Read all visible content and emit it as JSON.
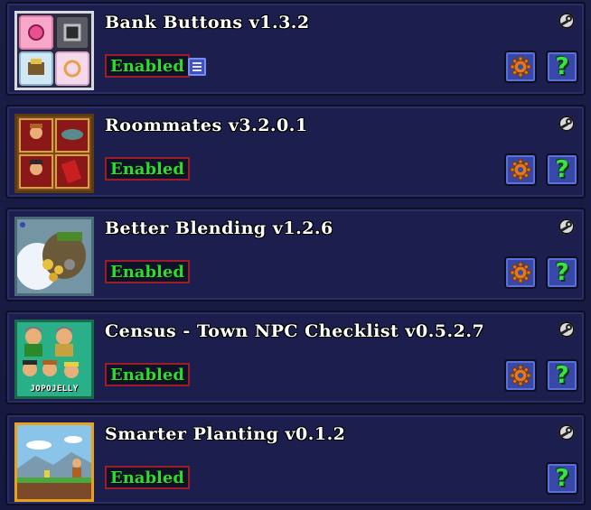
{
  "mods": [
    {
      "title": "Bank Buttons v1.3.2",
      "status": "Enabled",
      "icon": "bank-buttons-icon",
      "has_config": true,
      "has_info": true,
      "has_extra_icon": true
    },
    {
      "title": "Roommates v3.2.0.1",
      "status": "Enabled",
      "icon": "roommates-icon",
      "has_config": true,
      "has_info": true
    },
    {
      "title": "Better Blending v1.2.6",
      "status": "Enabled",
      "icon": "better-blending-icon",
      "has_config": true,
      "has_info": true
    },
    {
      "title": "Census - Town NPC Checklist v0.5.2.7",
      "status": "Enabled",
      "icon": "census-icon",
      "icon_caption": "JOPOJELLY",
      "has_config": true,
      "has_info": true
    },
    {
      "title": "Smarter Planting v0.1.2",
      "status": "Enabled",
      "icon": "smarter-planting-icon",
      "has_config": false,
      "has_info": true
    }
  ],
  "info_glyph": "?",
  "colors": {
    "panel_bg": "#1c1f4d",
    "enabled_text": "#2edc2e",
    "enabled_border": "#9c1c2c",
    "button_blue": "#3848a8",
    "gear_orange": "#e07a1a",
    "info_green": "#3ce04a"
  }
}
